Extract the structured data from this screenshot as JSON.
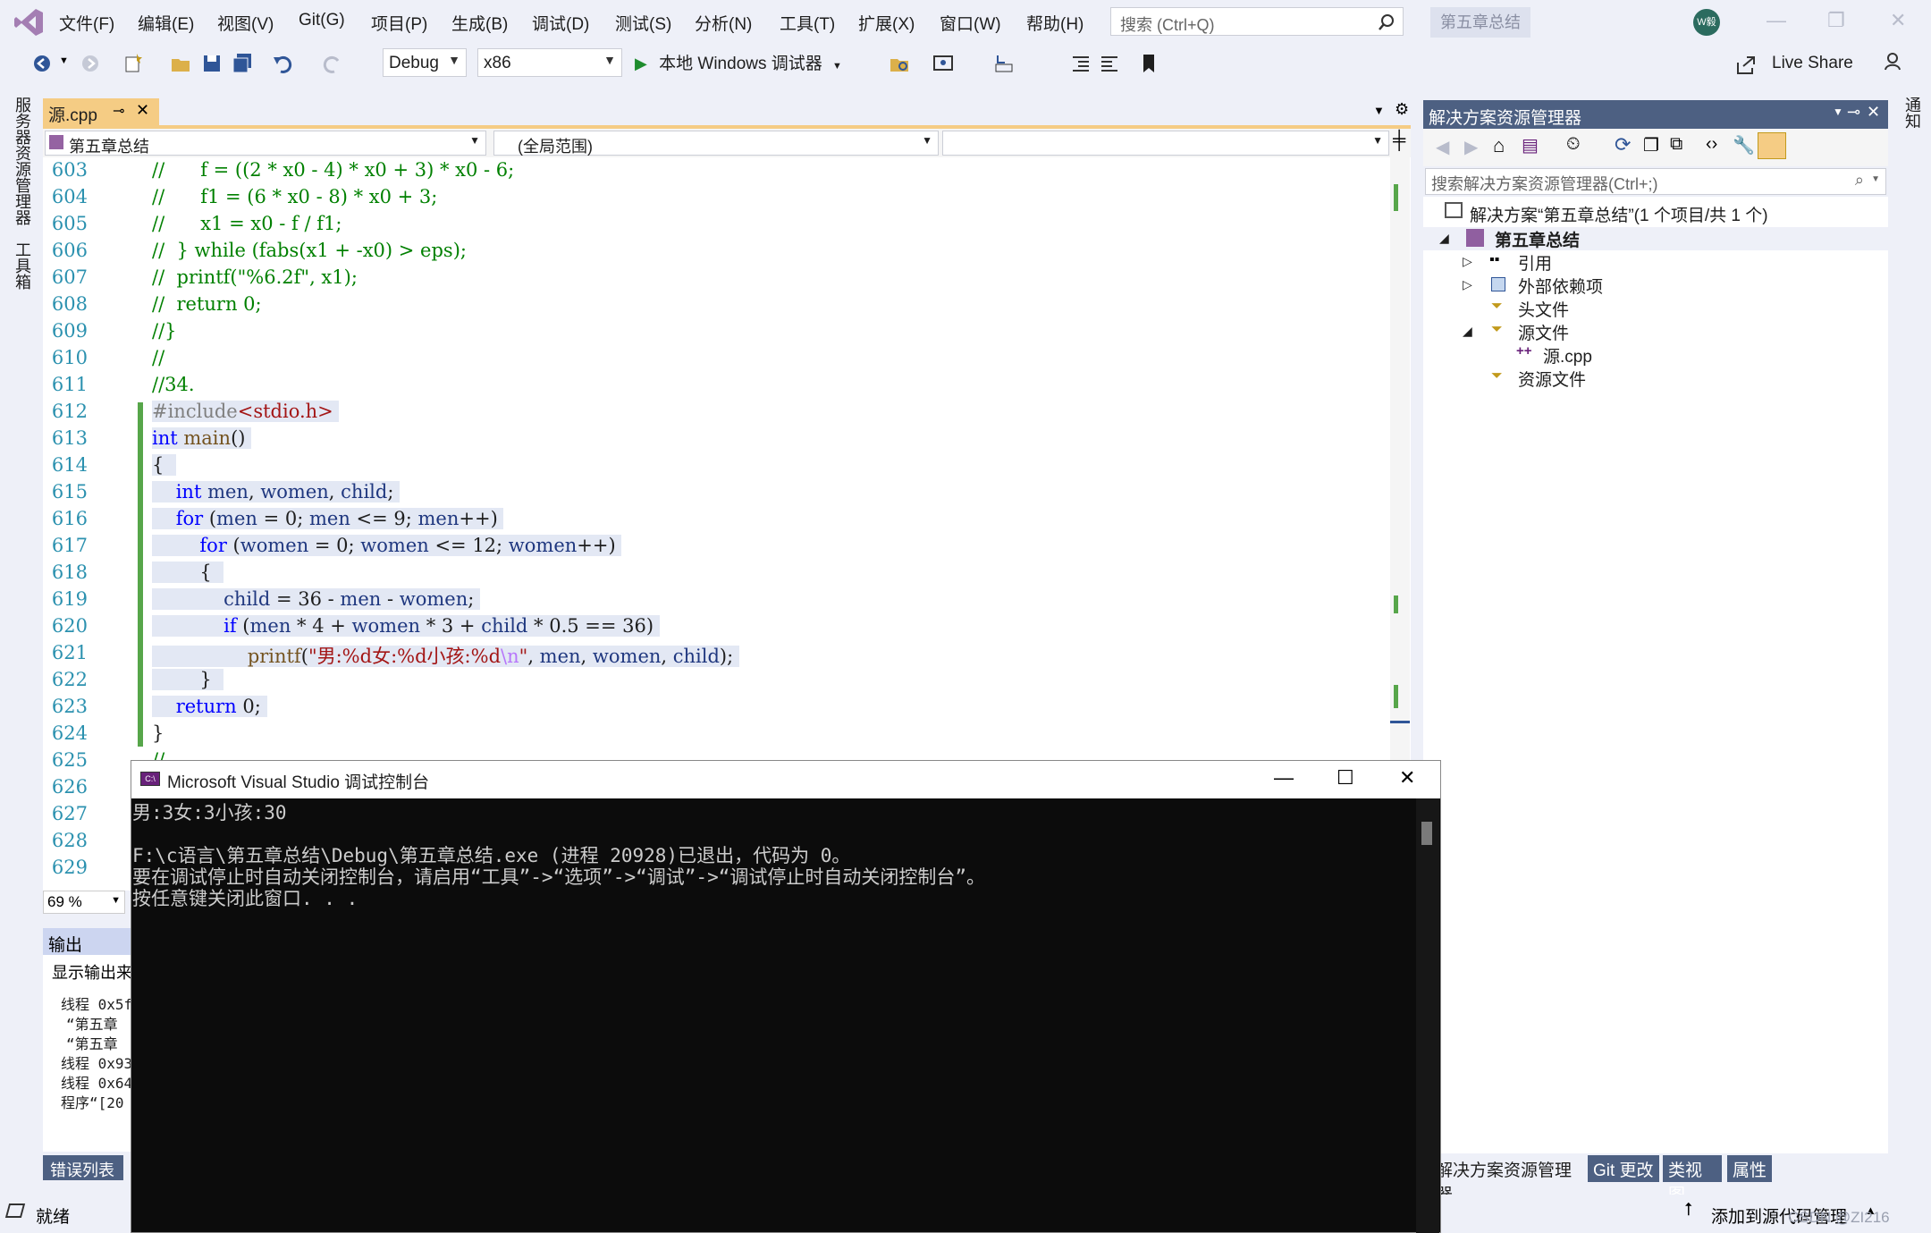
{
  "menubar": {
    "items": [
      "文件(F)",
      "编辑(E)",
      "视图(V)",
      "Git(G)",
      "项目(P)",
      "生成(B)",
      "调试(D)",
      "测试(S)",
      "分析(N)",
      "工具(T)",
      "扩展(X)",
      "窗口(W)",
      "帮助(H)"
    ],
    "search_placeholder": "搜索 (Ctrl+Q)",
    "solution_name": "第五章总结",
    "avatar_initials": "W毅"
  },
  "toolbar": {
    "config": "Debug",
    "platform": "x86",
    "run_label": "本地 Windows 调试器",
    "liveshare_label": "Live Share"
  },
  "left_rail": {
    "tab1": "服务器资源管理器",
    "tab2": "工具箱"
  },
  "right_rail": {
    "tab1": "通知"
  },
  "editor": {
    "tab_name": "源.cpp",
    "nav_project": "第五章总结",
    "nav_scope": "(全局范围)",
    "zoom": "69 %",
    "line_numbers": [
      "603",
      "604",
      "605",
      "606",
      "607",
      "608",
      "609",
      "610",
      "611",
      "612",
      "613",
      "614",
      "615",
      "616",
      "617",
      "618",
      "619",
      "620",
      "621",
      "622",
      "623",
      "624",
      "625",
      "626",
      "627",
      "628",
      "629"
    ]
  },
  "output": {
    "title": "输出",
    "source_label": "显示输出来",
    "lines": [
      "线程 0x5f",
      "“第五章",
      "“第五章",
      "线程 0x93",
      "线程 0x64",
      "程序“[20"
    ],
    "error_tab": "错误列表"
  },
  "solution_explorer": {
    "title": "解决方案资源管理器",
    "search_placeholder": "搜索解决方案资源管理器(Ctrl+;)",
    "solution_node": "解决方案“第五章总结”(1 个项目/共 1 个)",
    "project_node": "第五章总结",
    "nodes": [
      "引用",
      "外部依赖项",
      "头文件",
      "源文件",
      "源.cpp",
      "资源文件"
    ],
    "bottom_tabs": [
      "解决方案资源管理器",
      "Git 更改",
      "类视图",
      "属性"
    ]
  },
  "statusbar": {
    "ready": "就绪",
    "source_control": "添加到源代码管理",
    "watermark": "CSDN @ZI216"
  },
  "console": {
    "title": "Microsoft Visual Studio 调试控制台",
    "lines": [
      "男:3女:3小孩:30",
      "",
      "F:\\c语言\\第五章总结\\Debug\\第五章总结.exe (进程 20928)已退出，代码为 0。",
      "要在调试停止时自动关闭控制台，请启用“工具”->“选项”->“调试”->“调试停止时自动关闭控制台”。",
      "按任意键关闭此窗口. . ."
    ]
  }
}
